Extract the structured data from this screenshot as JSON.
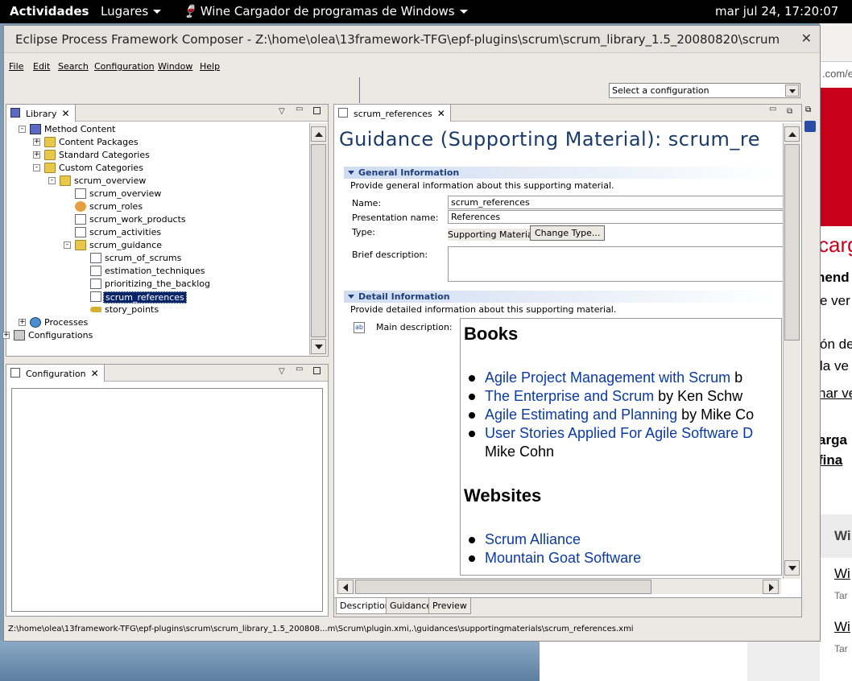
{
  "topbar": {
    "activities": "Actividades",
    "places": "Lugares",
    "app_menu": "Wine Cargador de programas de Windows",
    "clock": "mar jul 24, 17:20:07"
  },
  "window": {
    "title": "Eclipse Process Framework Composer - Z:\\home\\olea\\13framework-TFG\\epf-plugins\\scrum\\scrum_library_1.5_20080820\\scrum",
    "close": "✕"
  },
  "menu": [
    "File",
    "Edit",
    "Search",
    "Configuration",
    "Window",
    "Help"
  ],
  "config_select": {
    "value": "Select a configuration"
  },
  "library_view": {
    "tab_label": "Library",
    "tree": [
      {
        "label": "Method Content",
        "level": 1,
        "expander": "-",
        "icon": "folder-lib"
      },
      {
        "label": "Content Packages",
        "level": 2,
        "expander": "+",
        "icon": "folder"
      },
      {
        "label": "Standard Categories",
        "level": 2,
        "expander": "+",
        "icon": "folder"
      },
      {
        "label": "Custom Categories",
        "level": 2,
        "expander": "-",
        "icon": "folder"
      },
      {
        "label": "scrum_overview",
        "level": 3,
        "expander": "-",
        "icon": "folder"
      },
      {
        "label": "scrum_overview",
        "level": 4,
        "expander": "",
        "icon": "doc"
      },
      {
        "label": "scrum_roles",
        "level": 4,
        "expander": "",
        "icon": "roles"
      },
      {
        "label": "scrum_work_products",
        "level": 4,
        "expander": "",
        "icon": "doc"
      },
      {
        "label": "scrum_activities",
        "level": 4,
        "expander": "",
        "icon": "doc"
      },
      {
        "label": "scrum_guidance",
        "level": 4,
        "expander": "-",
        "icon": "folder"
      },
      {
        "label": "scrum_of_scrums",
        "level": 5,
        "expander": "",
        "icon": "doc"
      },
      {
        "label": "estimation_techniques",
        "level": 5,
        "expander": "",
        "icon": "doc"
      },
      {
        "label": "prioritizing_the_backlog",
        "level": 5,
        "expander": "",
        "icon": "doc"
      },
      {
        "label": "scrum_references",
        "level": 5,
        "expander": "",
        "icon": "doc",
        "selected": true
      },
      {
        "label": "story_points",
        "level": 5,
        "expander": "",
        "icon": "key"
      },
      {
        "label": "Processes",
        "level": 1,
        "expander": "+",
        "icon": "process"
      },
      {
        "label": "Configurations",
        "level": 0,
        "expander": "+",
        "icon": "config"
      }
    ]
  },
  "configuration_view": {
    "tab_label": "Configuration"
  },
  "editor": {
    "tab_label": "scrum_references",
    "heading": "Guidance (Supporting Material): scrum_re",
    "general": {
      "title": "General Information",
      "desc": "Provide general information about this supporting material.",
      "name_label": "Name:",
      "name_value": "scrum_references",
      "presentation_label": "Presentation name:",
      "presentation_value": "References",
      "type_label": "Type:",
      "type_value": "Supporting Material",
      "change_type": "Change Type...",
      "brief_label": "Brief description:"
    },
    "detail": {
      "title": "Detail Information",
      "desc": "Provide detailed information about this supporting material.",
      "main_label": "Main description:"
    },
    "content": {
      "books_heading": "Books",
      "books": [
        {
          "link": "Agile Project Management with Scrum",
          "after": "  b"
        },
        {
          "link": "The Enterprise and Scrum",
          "after": "  by Ken Schw"
        },
        {
          "link": "Agile Estimating and Planning",
          "after": " by Mike Co"
        },
        {
          "link": "User Stories Applied For Agile Software D",
          "after": ""
        }
      ],
      "books_wrap": "Mike Cohn",
      "websites_heading": "Websites",
      "websites": [
        "Scrum Alliance",
        "Mountain Goat Software"
      ]
    },
    "bottom_tabs": [
      "Description",
      "Guidance",
      "Preview"
    ]
  },
  "status_text": "Z:\\home\\olea\\13framework-TFG\\epf-plugins\\scrum\\scrum_library_1.5_200808...m\\Scrum\\plugin.xmi,.\\guidances\\supportingmaterials\\scrum_references.xmi",
  "browser_bg": {
    "url_fragment": ".com/e",
    "t1": "carg",
    "t2": "nend",
    "t3": "e ver",
    "t4": "ón de",
    "t5": "la ve",
    "t6": "nar ve",
    "t7": "arga",
    "t8": " fina",
    "t9": "Wi",
    "t10": "Wi",
    "t11": "Tar",
    "t12": "Wi",
    "t13": "Tar"
  }
}
